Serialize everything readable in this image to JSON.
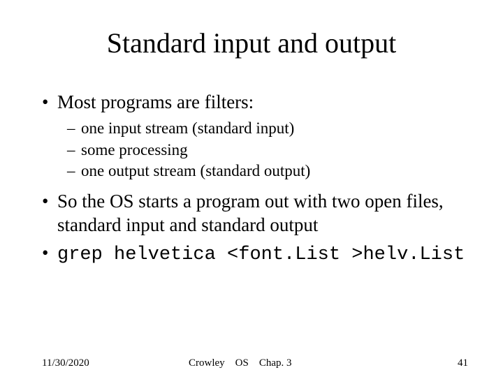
{
  "title": "Standard input and output",
  "bullets": {
    "b1_0": "Most programs are filters:",
    "b2_0": "one input stream (standard input)",
    "b2_1": "some processing",
    "b2_2": "one output stream (standard output)",
    "b1_1": "So the OS starts a program out with two open files, standard input and standard output",
    "b1_2": "grep helvetica <font.List >helv.List"
  },
  "footer": {
    "date": "11/30/2020",
    "center": "Crowley OS Chap. 3",
    "page": "41"
  }
}
